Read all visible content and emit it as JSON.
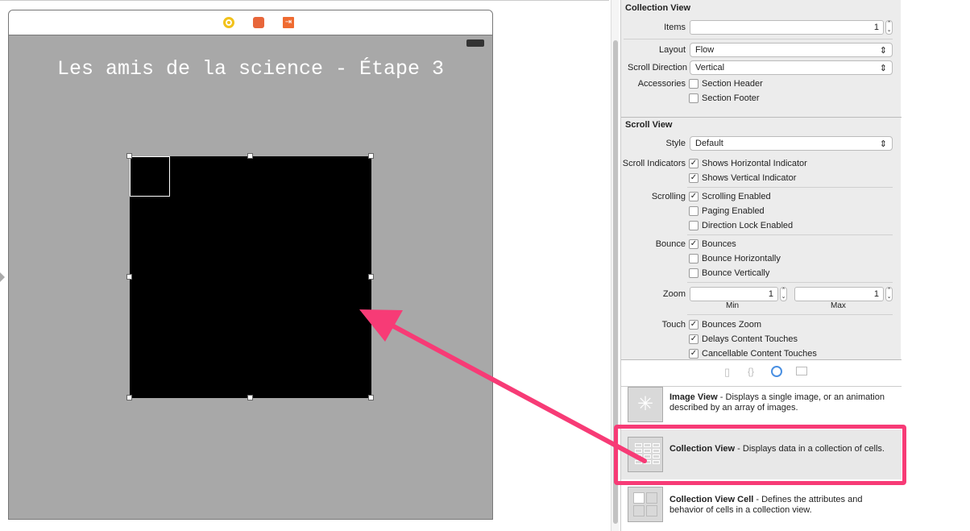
{
  "scene": {
    "title": "Les amis de la science - Étape 3",
    "icons": [
      "view-controller-icon",
      "first-responder-icon",
      "exit-icon"
    ]
  },
  "inspector": {
    "collection_view": {
      "heading": "Collection View",
      "items_label": "Items",
      "items_value": "1",
      "layout_label": "Layout",
      "layout_value": "Flow",
      "scroll_direction_label": "Scroll Direction",
      "scroll_direction_value": "Vertical",
      "accessories_label": "Accessories",
      "section_header": {
        "label": "Section Header",
        "checked": false
      },
      "section_footer": {
        "label": "Section Footer",
        "checked": false
      }
    },
    "scroll_view": {
      "heading": "Scroll View",
      "style_label": "Style",
      "style_value": "Default",
      "scroll_indicators_label": "Scroll Indicators",
      "horizontal": {
        "label": "Shows Horizontal Indicator",
        "checked": true
      },
      "vertical": {
        "label": "Shows Vertical Indicator",
        "checked": true
      },
      "scrolling_label": "Scrolling",
      "scrolling_enabled": {
        "label": "Scrolling Enabled",
        "checked": true
      },
      "paging": {
        "label": "Paging Enabled",
        "checked": false
      },
      "direction_lock": {
        "label": "Direction Lock Enabled",
        "checked": false
      },
      "bounce_label": "Bounce",
      "bounces": {
        "label": "Bounces",
        "checked": true
      },
      "bounce_h": {
        "label": "Bounce Horizontally",
        "checked": false
      },
      "bounce_v": {
        "label": "Bounce Vertically",
        "checked": false
      },
      "zoom_label": "Zoom",
      "zoom_min": "1",
      "zoom_max": "1",
      "min_label": "Min",
      "max_label": "Max",
      "touch_label": "Touch",
      "bounces_zoom": {
        "label": "Bounces Zoom",
        "checked": true
      },
      "delays": {
        "label": "Delays Content Touches",
        "checked": true
      },
      "cancellable": {
        "label": "Cancellable Content Touches",
        "checked": true
      }
    }
  },
  "library": {
    "tabs": [
      "file-icon",
      "braces-icon",
      "object-icon",
      "media-icon"
    ],
    "items": [
      {
        "name": "Image View",
        "desc": " - Displays a single image, or an animation described by an array of images."
      },
      {
        "name": "Collection View",
        "desc": " - Displays data in a collection of cells."
      },
      {
        "name": "Collection View Cell",
        "desc": " - Defines the attributes and behavior of cells in a collection view."
      }
    ]
  },
  "annotation": {
    "color": "#f73b76"
  }
}
